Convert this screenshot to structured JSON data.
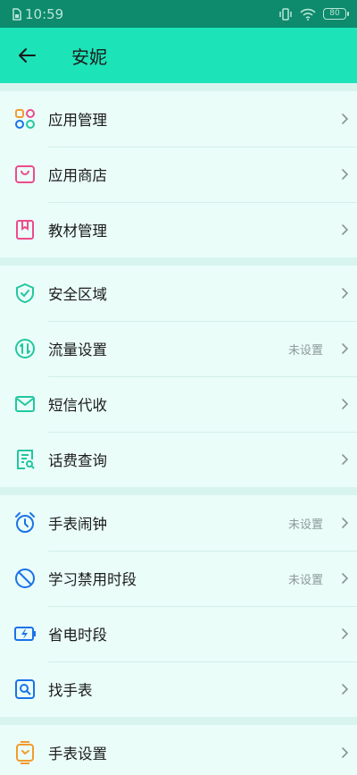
{
  "status_bar": {
    "time": "10:59",
    "battery": "80"
  },
  "header": {
    "title": "安妮"
  },
  "groups": [
    [
      {
        "label": "应用管理",
        "icon": "apps-grid-icon",
        "status": ""
      },
      {
        "label": "应用商店",
        "icon": "store-bag-icon",
        "status": ""
      },
      {
        "label": "教材管理",
        "icon": "book-icon",
        "status": ""
      }
    ],
    [
      {
        "label": "安全区域",
        "icon": "shield-check-icon",
        "status": ""
      },
      {
        "label": "流量设置",
        "icon": "data-traffic-icon",
        "status": "未设置"
      },
      {
        "label": "短信代收",
        "icon": "mail-icon",
        "status": ""
      },
      {
        "label": "话费查询",
        "icon": "bill-search-icon",
        "status": ""
      }
    ],
    [
      {
        "label": "手表闹钟",
        "icon": "alarm-clock-icon",
        "status": "未设置"
      },
      {
        "label": "学习禁用时段",
        "icon": "no-entry-icon",
        "status": "未设置"
      },
      {
        "label": "省电时段",
        "icon": "battery-bolt-icon",
        "status": ""
      },
      {
        "label": "找手表",
        "icon": "find-watch-icon",
        "status": ""
      }
    ],
    [
      {
        "label": "手表设置",
        "icon": "watch-icon",
        "status": ""
      }
    ]
  ],
  "colors": {
    "header_bg": "#1de3b8",
    "status_bar_bg": "#0e8a6c",
    "list_bg": "#eafdf9",
    "orange": "#f39b2f",
    "pink": "#ec4c8c",
    "teal": "#22c7a0",
    "blue": "#1a73e8"
  }
}
